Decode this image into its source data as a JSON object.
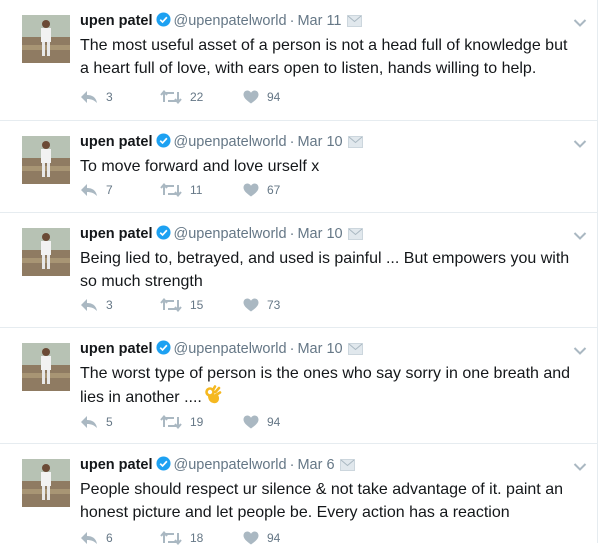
{
  "tweets": [
    {
      "name": "upen patel",
      "handle": "@upenpatelworld",
      "separator": "·",
      "date": "Mar 11",
      "text": "The most useful asset of a person is not a head full of knowledge but a heart full of love, with ears open to listen, hands willing to help.",
      "emoji": "",
      "replies": "3",
      "retweets": "22",
      "likes": "94"
    },
    {
      "name": "upen patel",
      "handle": "@upenpatelworld",
      "separator": "·",
      "date": "Mar 10",
      "text": "To move forward and love urself x",
      "emoji": "",
      "replies": "7",
      "retweets": "11",
      "likes": "67"
    },
    {
      "name": "upen patel",
      "handle": "@upenpatelworld",
      "separator": "·",
      "date": "Mar 10",
      "text": "Being lied to, betrayed, and used is painful ... But empowers you with so much strength",
      "emoji": "",
      "replies": "3",
      "retweets": "15",
      "likes": "73"
    },
    {
      "name": "upen patel",
      "handle": "@upenpatelworld",
      "separator": "·",
      "date": "Mar 10",
      "text": "The worst type of person is the ones who say sorry in one breath and lies in another ....",
      "emoji": "ok-hand-emoji",
      "replies": "5",
      "retweets": "19",
      "likes": "94"
    },
    {
      "name": "upen patel",
      "handle": "@upenpatelworld",
      "separator": "·",
      "date": "Mar 6",
      "text": "People should respect ur silence & not take advantage of it. paint an honest picture and let people be. Every action has a reaction",
      "emoji": "",
      "replies": "6",
      "retweets": "18",
      "likes": "94"
    }
  ],
  "colors": {
    "verified": "#1da1f2",
    "muted": "#657786",
    "action_icon": "#aab8c2",
    "border": "#e6ecf0"
  }
}
